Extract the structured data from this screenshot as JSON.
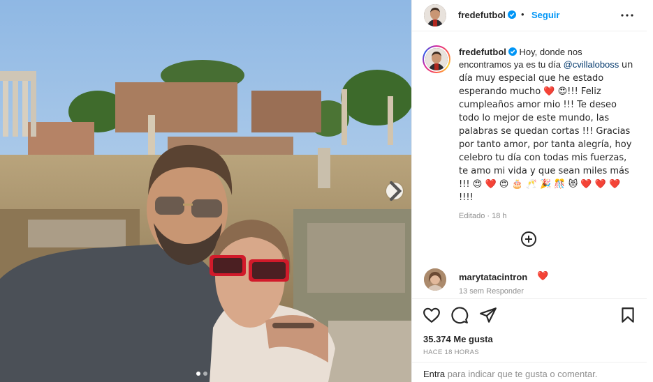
{
  "post": {
    "username": "fredefutbol",
    "separator": "•",
    "follow_label": "Seguir"
  },
  "caption": {
    "username": "fredefutbol",
    "part1": "Hoy, donde nos encontramos ya es tu día",
    "mention": "@cvillaloboss",
    "part2": "un día muy especial que he estado esperando mucho ❤️ 😍!!! Feliz cumpleaños amor mio !!! Te deseo todo lo mejor de este mundo, las palabras se quedan cortas !!! Gracias por tanto amor, por tanta alegría, hoy celebro tu día con todas mis fuerzas, te amo mi vida y que sean miles más !!! 😍 ❤️ 😍 🎂 🥂 🎉 🎊 😻 ❤️ ❤️ ❤️ !!!!",
    "edited": "Editado · 18 h"
  },
  "comment": {
    "username": "marytatacintron",
    "text": "❤️",
    "meta": "13 sem   Responder"
  },
  "stats": {
    "likes": "35.374 Me gusta",
    "time": "HACE 18 HORAS"
  },
  "footer": {
    "link": "Entra",
    "text": " para indicar que te gusta o comentar."
  },
  "icons": {
    "verified": "verified-badge-icon",
    "more": "more-options-icon",
    "add_comment": "plus-circle-icon",
    "like": "heart-icon",
    "comment": "comment-icon",
    "share": "share-icon",
    "save": "bookmark-icon",
    "next": "chevron-right-icon"
  },
  "colors": {
    "accent": "#0095f6",
    "mention": "#00376b",
    "muted": "#8e8e8e",
    "heart": "#e0245e"
  },
  "carousel": {
    "slide_count": 2,
    "active_index": 0
  }
}
